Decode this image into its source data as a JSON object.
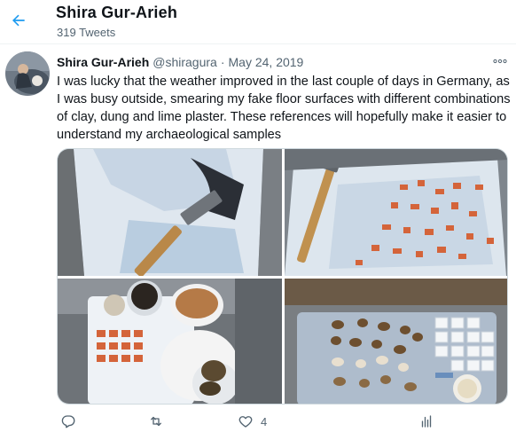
{
  "header": {
    "name": "Shira Gur-Arieh",
    "tweet_count": "319 Tweets"
  },
  "tweet": {
    "author_name": "Shira Gur-Arieh",
    "handle": "@shiragura",
    "separator": "·",
    "date": "May 24, 2019",
    "text": "I was lucky that the weather improved in the last couple of days in Germany, as I was busy outside, smearing my fake floor surfaces with different combinations of clay, dung and lime plaster. These references will hopefully make it easier to understand my archaeological samples",
    "like_count": "4"
  },
  "icons": {
    "back": "arrow-left-icon",
    "more": "more-horizontal-icon",
    "reply": "reply-icon",
    "retweet": "retweet-icon",
    "like": "heart-icon",
    "analytics": "analytics-icon"
  },
  "colors": {
    "accent": "#1d9bf0",
    "secondary_text": "#536471",
    "border": "#cfd9de"
  }
}
